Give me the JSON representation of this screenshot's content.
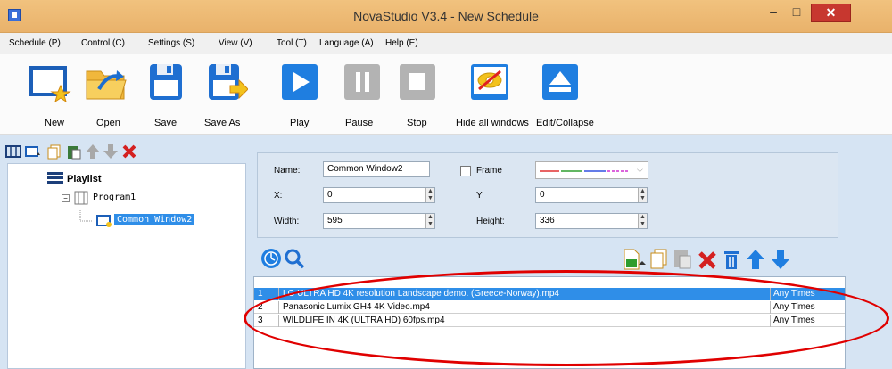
{
  "window": {
    "title": "NovaStudio V3.4 - New Schedule"
  },
  "menubar": {
    "items": [
      "Schedule (P)",
      "Control (C)",
      "Settings (S)",
      "View (V)",
      "Tool (T)",
      "Language (A)",
      "Help (E)"
    ]
  },
  "toolbar": {
    "new_label": "New",
    "open_label": "Open",
    "save_label": "Save",
    "save_as_label": "Save As",
    "play_label": "Play",
    "pause_label": "Pause",
    "stop_label": "Stop",
    "hide_label": "Hide all windows",
    "edit_collapse_label": "Edit/Collapse"
  },
  "tree": {
    "playlist_label": "Playlist",
    "program_label": "Program1",
    "window_label": "Common Window2"
  },
  "props": {
    "name_label": "Name:",
    "name_value": "Common Window2",
    "frame_label": "Frame",
    "x_label": "X:",
    "x_value": "0",
    "y_label": "Y:",
    "y_value": "0",
    "width_label": "Width:",
    "width_value": "595",
    "height_label": "Height:",
    "height_value": "336"
  },
  "media_list": {
    "rows": [
      {
        "num": "1",
        "name": "LG ULTRA HD 4K resolution Landscape demo. (Greece-Norway).mp4",
        "times": "Any Times",
        "selected": true
      },
      {
        "num": "2",
        "name": "Panasonic Lumix GH4 4K Video.mp4",
        "times": "Any Times",
        "selected": false
      },
      {
        "num": "3",
        "name": "WILDLIFE IN 4K (ULTRA HD) 60fps.mp4",
        "times": "Any Times",
        "selected": false
      }
    ]
  },
  "colors": {
    "accent": "#2f8ee8",
    "panel_bg": "#d6e4f3",
    "annotation": "#e00000"
  }
}
